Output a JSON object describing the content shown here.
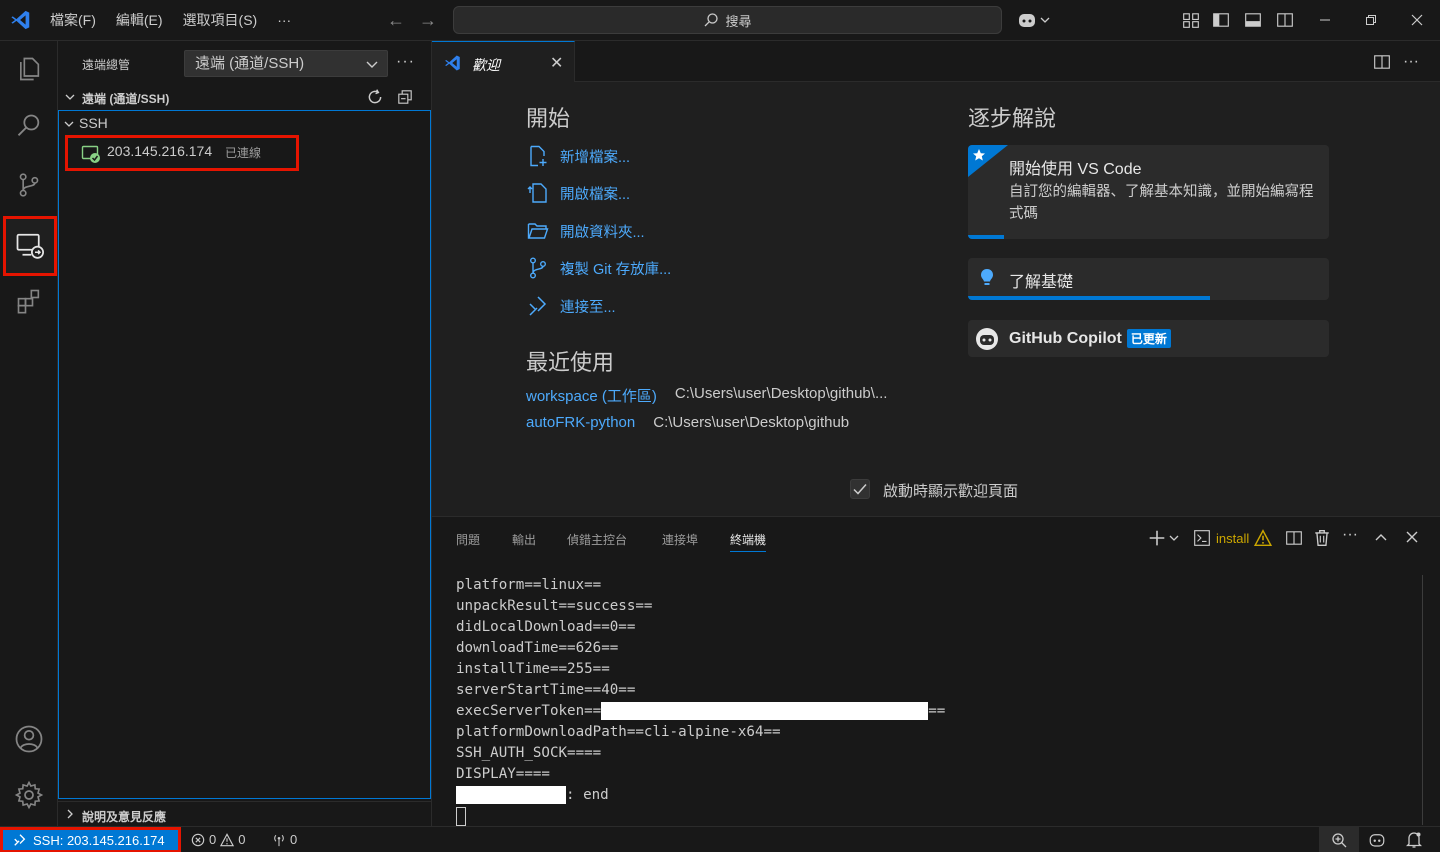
{
  "titlebar": {
    "menu": [
      "檔案(F)",
      "編輯(E)",
      "選取項目(S)",
      "···"
    ],
    "search_placeholder": "搜尋"
  },
  "sidebar": {
    "title": "遠端總管",
    "select_value": "遠端 (通道/SSH)",
    "section_title": "遠端 (通道/SSH)",
    "group": "SSH",
    "host_ip": "203.145.216.174",
    "host_status": "已連線",
    "footer": "說明及意見反應"
  },
  "editor": {
    "tab_label": "歡迎",
    "start_heading": "開始",
    "actions": [
      "新增檔案...",
      "開啟檔案...",
      "開啟資料夾...",
      "複製 Git 存放庫...",
      "連接至..."
    ],
    "recent_heading": "最近使用",
    "recent": [
      {
        "name": "workspace (工作區)",
        "path": "C:\\Users\\user\\Desktop\\github\\..."
      },
      {
        "name": "autoFRK-python",
        "path": "C:\\Users\\user\\Desktop\\github"
      }
    ],
    "walkthrough_heading": "逐步解說",
    "walkthroughs": [
      {
        "title": "開始使用 VS Code",
        "desc": "自訂您的編輯器、了解基本知識，並開始編寫程式碼",
        "progress": 0.1
      },
      {
        "title": "了解基礎",
        "progress": 0.67
      },
      {
        "title": "GitHub Copilot",
        "badge": "已更新"
      }
    ],
    "show_on_startup": "啟動時顯示歡迎頁面"
  },
  "panel": {
    "tabs": [
      "問題",
      "輸出",
      "偵錯主控台",
      "連接埠",
      "終端機"
    ],
    "active_tab": "終端機",
    "terminal_name": "install",
    "lines": [
      "platform==linux==",
      "unpackResult==success==",
      "didLocalDownload==0==",
      "downloadTime==626==",
      "installTime==255==",
      "serverStartTime==40==",
      "execServerToken==",
      "platformDownloadPath==cli-alpine-x64==",
      "SSH_AUTH_SOCK====",
      "DISPLAY===="
    ],
    "token_suffix": "==",
    "end_suffix": ": end"
  },
  "statusbar": {
    "remote": "SSH: 203.145.216.174",
    "errors": "0",
    "warnings": "0",
    "ports": "0"
  },
  "colors": {
    "accent": "#0078d4",
    "highlight_box": "#e51400",
    "link": "#4daafc"
  }
}
